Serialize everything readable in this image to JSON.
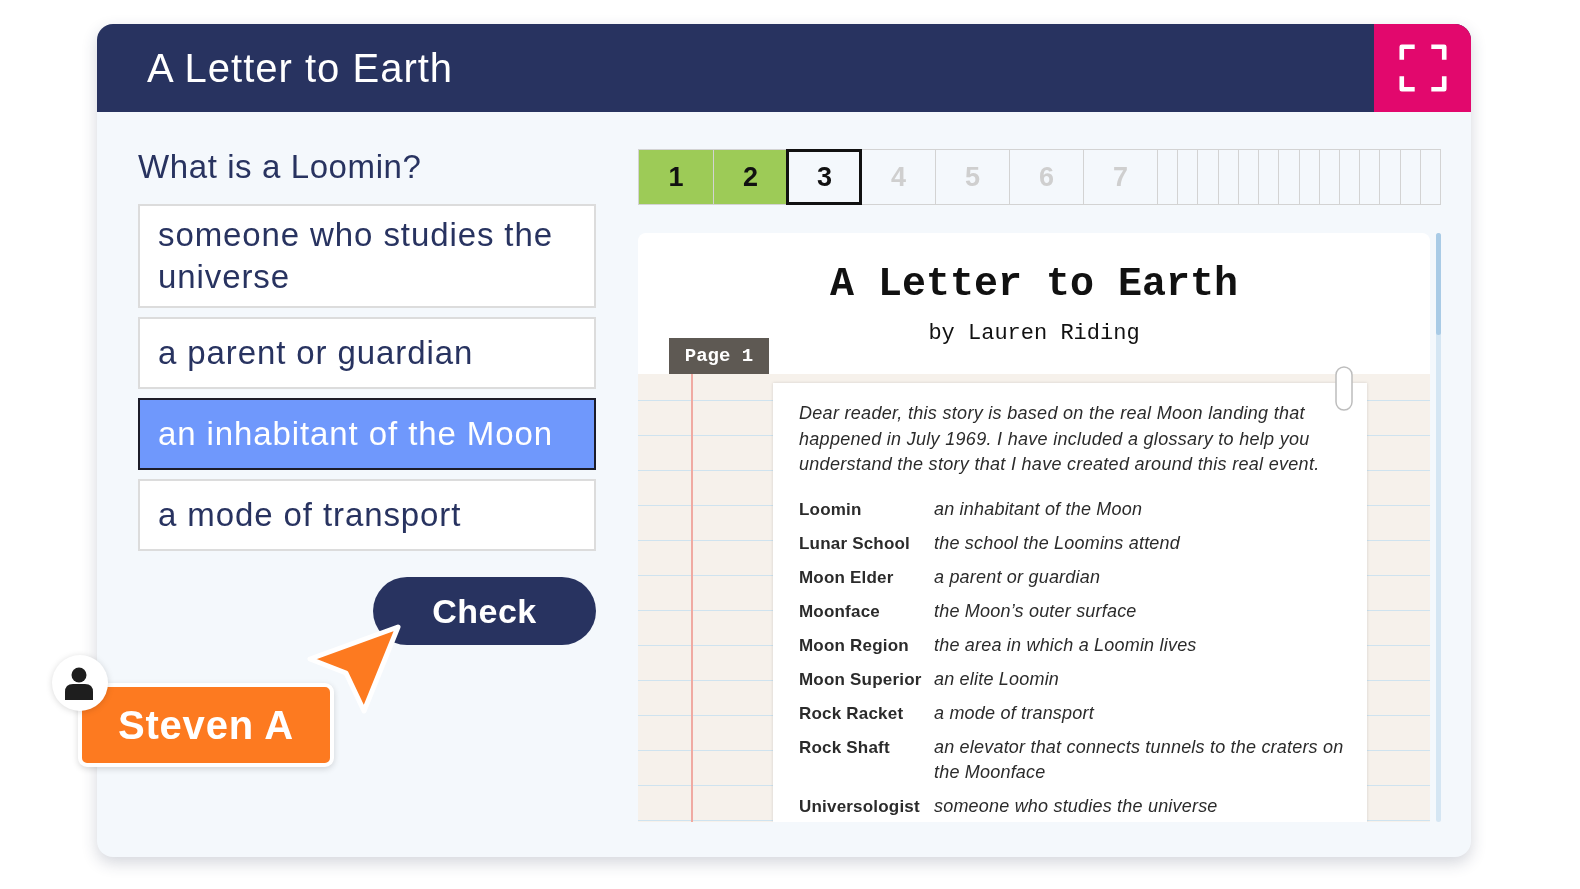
{
  "header": {
    "title": "A Letter to Earth"
  },
  "question": {
    "prompt": "What is a Loomin?",
    "options": [
      {
        "text": "someone who studies the universe",
        "selected": false
      },
      {
        "text": "a parent or guardian",
        "selected": false
      },
      {
        "text": "an inhabitant of the Moon",
        "selected": true
      },
      {
        "text": "a mode of transport",
        "selected": false
      }
    ],
    "submit_button": "Check"
  },
  "progress": {
    "steps": [
      {
        "label": "1",
        "completed": true,
        "selected": false
      },
      {
        "label": "2",
        "completed": true,
        "selected": false
      },
      {
        "label": "3",
        "completed": false,
        "selected": true
      },
      {
        "label": "4",
        "completed": false,
        "selected": false
      },
      {
        "label": "5",
        "completed": false,
        "selected": false
      },
      {
        "label": "6",
        "completed": false,
        "selected": false
      },
      {
        "label": "7",
        "completed": false,
        "selected": false
      },
      {
        "completed": false,
        "selected": false
      },
      {
        "completed": false,
        "selected": false
      },
      {
        "completed": false,
        "selected": false
      },
      {
        "completed": false,
        "selected": false
      },
      {
        "completed": false,
        "selected": false
      },
      {
        "completed": false,
        "selected": false
      },
      {
        "completed": false,
        "selected": false
      },
      {
        "completed": false,
        "selected": false
      },
      {
        "completed": false,
        "selected": false
      },
      {
        "completed": false,
        "selected": false
      },
      {
        "completed": false,
        "selected": false
      },
      {
        "completed": false,
        "selected": false
      },
      {
        "completed": false,
        "selected": false
      },
      {
        "completed": false,
        "selected": false
      }
    ]
  },
  "document": {
    "title": "A Letter to Earth",
    "byline": "by Lauren Riding",
    "page_tag": "Page 1",
    "intro": "Dear reader, this story is based on the real Moon landing that happened in July 1969. I have included a glossary to help you understand the story that I have created around this real event.",
    "glossary": [
      {
        "term": "Loomin",
        "definition": "an inhabitant of the Moon"
      },
      {
        "term": "Lunar School",
        "definition": "the school the Loomins attend"
      },
      {
        "term": "Moon Elder",
        "definition": "a parent or guardian"
      },
      {
        "term": "Moonface",
        "definition": "the Moon’s outer surface"
      },
      {
        "term": "Moon Region",
        "definition": "the area in which a Loomin lives"
      },
      {
        "term": "Moon Superior",
        "definition": "an elite Loomin"
      },
      {
        "term": "Rock Racket",
        "definition": "a mode of transport"
      },
      {
        "term": "Rock Shaft",
        "definition": "an elevator that connects tunnels to the craters on the Moonface"
      },
      {
        "term": "Universologist",
        "definition": "someone who studies the universe"
      }
    ]
  },
  "collaborator": {
    "name": "Steven A"
  }
}
